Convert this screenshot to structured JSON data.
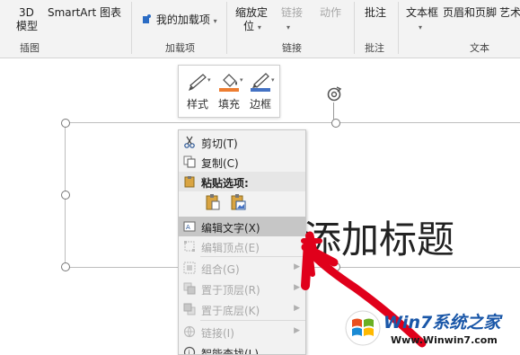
{
  "ribbon": {
    "btn_3d": "3D",
    "btn_3d_2": "模型",
    "btn_smartart": "SmartArt",
    "btn_chart": "图表",
    "btn_myaddins": "我的加载项",
    "btn_zoom": "缩放定",
    "btn_zoom_2": "位",
    "btn_link": "链接",
    "btn_action": "动作",
    "btn_comment": "批注",
    "btn_textbox": "文本框",
    "btn_header_footer": "页眉和页脚",
    "btn_art": "艺术",
    "groups": {
      "illustrations": "插图",
      "addins": "加载项",
      "links": "链接",
      "comments": "批注",
      "text": "文本"
    }
  },
  "mini_toolbar": {
    "style": "样式",
    "fill": "填充",
    "border": "边框"
  },
  "slide": {
    "title_placeholder": "添加标题"
  },
  "context_menu": {
    "items": [
      {
        "label": "剪切(T)"
      },
      {
        "label": "复制(C)"
      },
      {
        "label": "粘贴选项:"
      },
      {
        "label": "编辑文字(X)"
      },
      {
        "label": "编辑顶点(E)"
      },
      {
        "label": "组合(G)"
      },
      {
        "label": "置于顶层(R)"
      },
      {
        "label": "置于底层(K)"
      },
      {
        "label": "链接(I)"
      },
      {
        "label": "智能查找(L)"
      }
    ]
  },
  "watermark": {
    "brand": "Win7系统之家",
    "url": "Www.Winwin7.com"
  },
  "colors": {
    "fill_accent": "#ed7d31",
    "border_accent": "#4472c4",
    "annotation_red": "#e0001b"
  }
}
